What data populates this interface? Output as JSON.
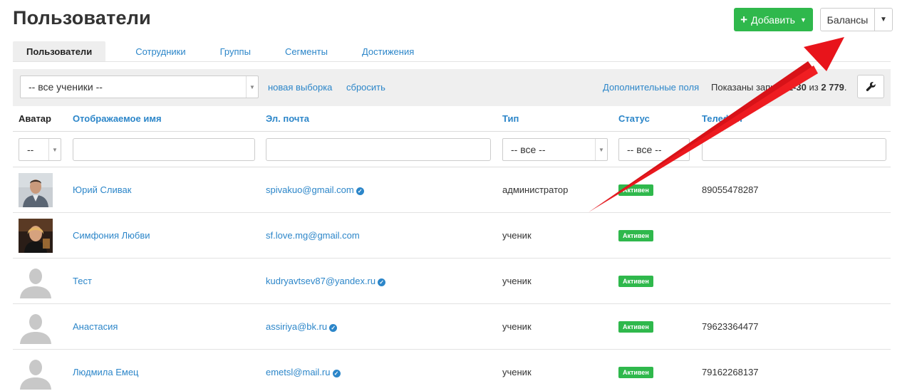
{
  "page": {
    "title": "Пользователи"
  },
  "header": {
    "add_label": "Добавить",
    "balances_label": "Балансы",
    "plus_icon": "plus-icon",
    "caret_icon": "caret-down-icon"
  },
  "tabs": [
    {
      "label": "Пользователи",
      "active": true
    },
    {
      "label": "Сотрудники",
      "active": false
    },
    {
      "label": "Группы",
      "active": false
    },
    {
      "label": "Сегменты",
      "active": false
    },
    {
      "label": "Достижения",
      "active": false
    }
  ],
  "toolbar": {
    "select_value": "-- все ученики --",
    "new_selection": "новая выборка",
    "reset": "сбросить",
    "extra_fields": "Дополнительные поля",
    "shown_prefix": "Показаны записи",
    "shown_range": "1-30",
    "shown_of": "из",
    "shown_total": "2 779",
    "shown_end": ".",
    "wrench_icon": "wrench-icon"
  },
  "table": {
    "columns": [
      "Аватар",
      "Отображаемое имя",
      "Эл. почта",
      "Тип",
      "Статус",
      "Телефон"
    ],
    "filters": {
      "avatar_select": "--",
      "type_select": "-- все --",
      "status_select": "-- все --"
    },
    "rows": [
      {
        "name": "Юрий Сливак",
        "email": "spivakuo@gmail.com",
        "verified": true,
        "type": "администратор",
        "status": "Активен",
        "phone": "89055478287",
        "avatar": "photo-man"
      },
      {
        "name": "Симфония Любви",
        "email": "sf.love.mg@gmail.com",
        "verified": false,
        "type": "ученик",
        "status": "Активен",
        "phone": "",
        "avatar": "photo-woman"
      },
      {
        "name": "Тест",
        "email": "kudryavtsev87@yandex.ru",
        "verified": true,
        "type": "ученик",
        "status": "Активен",
        "phone": "",
        "avatar": "placeholder"
      },
      {
        "name": "Анастасия",
        "email": "assiriya@bk.ru",
        "verified": true,
        "type": "ученик",
        "status": "Активен",
        "phone": "79623364477",
        "avatar": "placeholder"
      },
      {
        "name": "Людмила Емец",
        "email": "emetsl@mail.ru",
        "verified": true,
        "type": "ученик",
        "status": "Активен",
        "phone": "79162268137",
        "avatar": "placeholder"
      }
    ]
  },
  "colors": {
    "accent": "#2c86c9",
    "success": "#2fb84c",
    "annotation": "#e8141b"
  }
}
